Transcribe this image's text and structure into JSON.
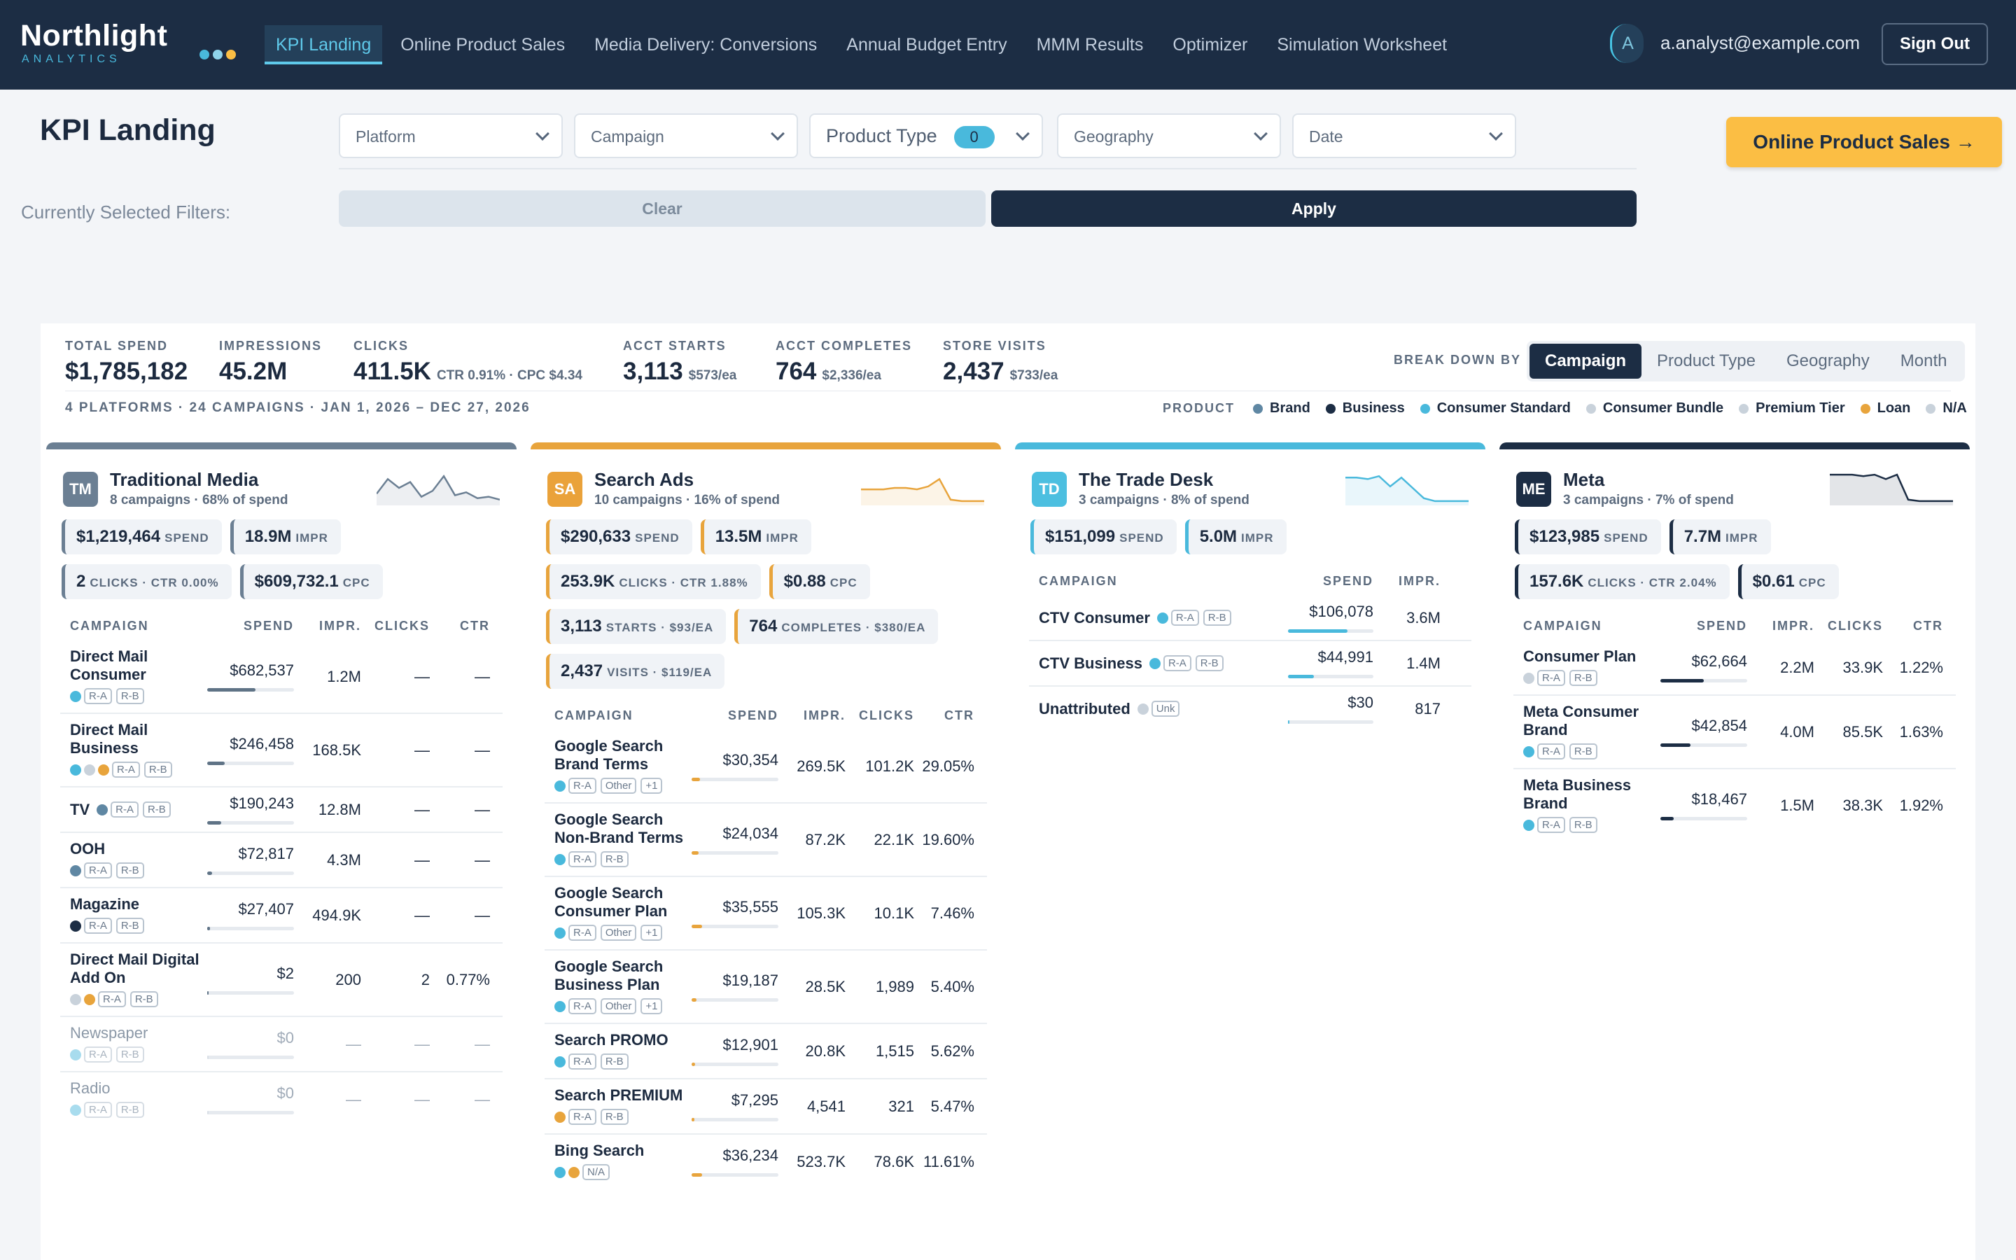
{
  "brand": {
    "name": "Northlight",
    "sub": "ANALYTICS",
    "dots": [
      "#49b9dc",
      "#8fd3ea",
      "#fbbe44"
    ]
  },
  "nav": {
    "tabs": [
      "KPI Landing",
      "Online Product Sales",
      "Media Delivery: Conversions",
      "Annual Budget Entry",
      "MMM Results",
      "Optimizer",
      "Simulation Worksheet"
    ],
    "active": 0,
    "avatar": "A",
    "email": "a.analyst@example.com",
    "sign_out": "Sign Out"
  },
  "page": {
    "title": "KPI Landing",
    "filters": {
      "platform": "Platform",
      "campaign": "Campaign",
      "product_type": "Product Type",
      "product_type_count": "0",
      "geography": "Geography",
      "date": "Date"
    },
    "currently_selected": "Currently Selected Filters:",
    "clear": "Clear",
    "apply": "Apply",
    "cta": "Online Product Sales  →"
  },
  "colors": {
    "navy": "#1c2d44",
    "cyan": "#49b9dc",
    "gold": "#fbbe44",
    "slate": "#6b7f93",
    "orange": "#e8a43c"
  },
  "kpis": [
    {
      "label": "TOTAL SPEND",
      "value": "$1,785,182",
      "sub": ""
    },
    {
      "label": "IMPRESSIONS",
      "value": "45.2M",
      "sub": ""
    },
    {
      "label": "CLICKS",
      "value": "411.5K",
      "sub": "CTR 0.91% · CPC $4.34"
    },
    {
      "label": "ACCT STARTS",
      "value": "3,113",
      "sub": "$573/ea"
    },
    {
      "label": "ACCT COMPLETES",
      "value": "764",
      "sub": "$2,336/ea"
    },
    {
      "label": "STORE VISITS",
      "value": "2,437",
      "sub": "$733/ea"
    }
  ],
  "breakdown": {
    "label": "BREAK DOWN BY",
    "options": [
      "Campaign",
      "Product Type",
      "Geography",
      "Month"
    ],
    "active": 0
  },
  "meta_line": "4 PLATFORMS · 24 CAMPAIGNS · JAN 1, 2026 – DEC 27, 2026",
  "legend": {
    "title": "PRODUCT",
    "items": [
      {
        "name": "Brand",
        "color": "#5f87a3"
      },
      {
        "name": "Business",
        "color": "#1c2d44"
      },
      {
        "name": "Consumer Standard",
        "color": "#49b9dc"
      },
      {
        "name": "Consumer Bundle",
        "color": "#c9d2db"
      },
      {
        "name": "Premium Tier",
        "color": "#c9d2db"
      },
      {
        "name": "Loan",
        "color": "#e8a43c"
      },
      {
        "name": "N/A",
        "color": "#c9d2db"
      }
    ]
  },
  "platforms": [
    {
      "code": "TM",
      "name": "Traditional Media",
      "sub": "8 campaigns · 68% of spend",
      "accent": "#6b7f93",
      "spark": [
        0.7,
        0.2,
        0.5,
        0.3,
        0.8,
        0.6,
        0.1,
        0.75,
        0.65,
        0.85,
        0.8,
        0.9
      ],
      "chips": [
        [
          {
            "v": "$1,219,464",
            "l": "SPEND"
          },
          {
            "v": "18.9M",
            "l": "IMPR"
          }
        ],
        [
          {
            "v": "2",
            "l": "CLICKS · CTR 0.00%"
          },
          {
            "v": "$609,732.1",
            "l": "CPC"
          }
        ]
      ],
      "cols": [
        "CAMPAIGN",
        "SPEND",
        "IMPR.",
        "CLICKS",
        "CTR"
      ],
      "rows": [
        {
          "name": "Direct Mail Consumer",
          "dots": [
            "#49b9dc"
          ],
          "tags": [
            "R-A",
            "R-B"
          ],
          "spend": "$682,537",
          "pct": 0.56,
          "impr": "1.2M",
          "clicks": "—",
          "ctr": "—"
        },
        {
          "name": "Direct Mail Business",
          "dots": [
            "#49b9dc",
            "#c9d2db",
            "#e8a43c"
          ],
          "tags": [
            "R-A",
            "R-B"
          ],
          "spend": "$246,458",
          "pct": 0.2,
          "impr": "168.5K",
          "clicks": "—",
          "ctr": "—"
        },
        {
          "name": "TV",
          "dots": [
            "#5f87a3"
          ],
          "tags": [
            "R-A",
            "R-B"
          ],
          "spend": "$190,243",
          "pct": 0.16,
          "impr": "12.8M",
          "clicks": "—",
          "ctr": "—",
          "inline": true
        },
        {
          "name": "OOH",
          "dots": [
            "#5f87a3"
          ],
          "tags": [
            "R-A",
            "R-B"
          ],
          "spend": "$72,817",
          "pct": 0.06,
          "impr": "4.3M",
          "clicks": "—",
          "ctr": "—"
        },
        {
          "name": "Magazine",
          "dots": [
            "#1c2d44"
          ],
          "tags": [
            "R-A",
            "R-B"
          ],
          "spend": "$27,407",
          "pct": 0.03,
          "impr": "494.9K",
          "clicks": "—",
          "ctr": "—"
        },
        {
          "name": "Direct Mail Digital Add On",
          "dots": [
            "#c9d2db",
            "#e8a43c"
          ],
          "tags": [
            "R-A",
            "R-B"
          ],
          "spend": "$2",
          "pct": 0.0,
          "impr": "200",
          "clicks": "2",
          "ctr": "0.77%"
        },
        {
          "name": "Newspaper",
          "dots": [
            "#a8dcee"
          ],
          "tags": [
            "R-A",
            "R-B"
          ],
          "spend": "$0",
          "pct": 0.0,
          "impr": "—",
          "clicks": "—",
          "ctr": "—",
          "muted": true
        },
        {
          "name": "Radio",
          "dots": [
            "#a8dcee"
          ],
          "tags": [
            "R-A",
            "R-B"
          ],
          "spend": "$0",
          "pct": 0.0,
          "impr": "—",
          "clicks": "—",
          "ctr": "—",
          "muted": true
        }
      ]
    },
    {
      "code": "SA",
      "name": "Search Ads",
      "sub": "10 campaigns · 16% of spend",
      "accent": "#e8a43c",
      "spark": [
        0.55,
        0.55,
        0.55,
        0.5,
        0.5,
        0.55,
        0.45,
        0.2,
        0.9,
        0.95,
        0.95,
        0.95
      ],
      "chips": [
        [
          {
            "v": "$290,633",
            "l": "SPEND"
          },
          {
            "v": "13.5M",
            "l": "IMPR"
          }
        ],
        [
          {
            "v": "253.9K",
            "l": "CLICKS · CTR 1.88%"
          },
          {
            "v": "$0.88",
            "l": "CPC"
          }
        ],
        [
          {
            "v": "3,113",
            "l": "STARTS · $93/EA"
          },
          {
            "v": "764",
            "l": "COMPLETES · $380/EA"
          }
        ],
        [
          {
            "v": "2,437",
            "l": "VISITS · $119/EA"
          }
        ]
      ],
      "cols": [
        "CAMPAIGN",
        "SPEND",
        "IMPR.",
        "CLICKS",
        "CTR"
      ],
      "rows": [
        {
          "name": "Google Search Brand Terms",
          "dots": [
            "#49b9dc"
          ],
          "tags": [
            "R-A",
            "Other",
            "+1"
          ],
          "spend": "$30,354",
          "pct": 0.1,
          "impr": "269.5K",
          "clicks": "101.2K",
          "ctr": "29.05%"
        },
        {
          "name": "Google Search Non-Brand Terms",
          "dots": [
            "#49b9dc"
          ],
          "tags": [
            "R-A",
            "R-B"
          ],
          "spend": "$24,034",
          "pct": 0.08,
          "impr": "87.2K",
          "clicks": "22.1K",
          "ctr": "19.60%"
        },
        {
          "name": "Google Search Consumer Plan",
          "dots": [
            "#49b9dc"
          ],
          "tags": [
            "R-A",
            "Other",
            "+1"
          ],
          "spend": "$35,555",
          "pct": 0.12,
          "impr": "105.3K",
          "clicks": "10.1K",
          "ctr": "7.46%"
        },
        {
          "name": "Google Search Business Plan",
          "dots": [
            "#49b9dc"
          ],
          "tags": [
            "R-A",
            "Other",
            "+1"
          ],
          "spend": "$19,187",
          "pct": 0.06,
          "impr": "28.5K",
          "clicks": "1,989",
          "ctr": "5.40%"
        },
        {
          "name": "Search PROMO",
          "dots": [
            "#49b9dc"
          ],
          "tags": [
            "R-A",
            "R-B"
          ],
          "spend": "$12,901",
          "pct": 0.04,
          "impr": "20.8K",
          "clicks": "1,515",
          "ctr": "5.62%"
        },
        {
          "name": "Search PREMIUM",
          "dots": [
            "#e8a43c"
          ],
          "tags": [
            "R-A",
            "R-B"
          ],
          "spend": "$7,295",
          "pct": 0.03,
          "impr": "4,541",
          "clicks": "321",
          "ctr": "5.47%"
        },
        {
          "name": "Bing Search",
          "dots": [
            "#49b9dc",
            "#e8a43c"
          ],
          "tags": [
            "N/A"
          ],
          "spend": "$36,234",
          "pct": 0.12,
          "impr": "523.7K",
          "clicks": "78.6K",
          "ctr": "11.61%"
        }
      ]
    },
    {
      "code": "TD",
      "name": "The Trade Desk",
      "sub": "3 campaigns · 8% of spend",
      "accent": "#49b9dc",
      "spark": [
        0.15,
        0.15,
        0.2,
        0.1,
        0.45,
        0.15,
        0.5,
        0.85,
        0.95,
        0.95,
        0.95,
        0.95
      ],
      "chips": [
        [
          {
            "v": "$151,099",
            "l": "SPEND"
          },
          {
            "v": "5.0M",
            "l": "IMPR"
          }
        ]
      ],
      "cols": [
        "CAMPAIGN",
        "SPEND",
        "IMPR."
      ],
      "rows": [
        {
          "name": "CTV Consumer",
          "dots": [
            "#49b9dc"
          ],
          "tags": [
            "R-A",
            "R-B"
          ],
          "spend": "$106,078",
          "pct": 0.7,
          "impr": "3.6M",
          "inline": true
        },
        {
          "name": "CTV Business",
          "dots": [
            "#49b9dc"
          ],
          "tags": [
            "R-A",
            "R-B"
          ],
          "spend": "$44,991",
          "pct": 0.3,
          "impr": "1.4M",
          "inline": true
        },
        {
          "name": "Unattributed",
          "dots": [
            "#c9d2db"
          ],
          "tags": [
            "Unk"
          ],
          "spend": "$30",
          "pct": 0.0,
          "impr": "817",
          "inline": true
        }
      ]
    },
    {
      "code": "ME",
      "name": "Meta",
      "sub": "3 campaigns · 7% of spend",
      "accent": "#1c2d44",
      "spark": [
        0.05,
        0.05,
        0.05,
        0.1,
        0.05,
        0.2,
        0.05,
        0.9,
        0.95,
        0.95,
        0.95,
        0.95
      ],
      "chips": [
        [
          {
            "v": "$123,985",
            "l": "SPEND"
          },
          {
            "v": "7.7M",
            "l": "IMPR"
          }
        ],
        [
          {
            "v": "157.6K",
            "l": "CLICKS · CTR 2.04%"
          },
          {
            "v": "$0.61",
            "l": "CPC"
          }
        ]
      ],
      "cols": [
        "CAMPAIGN",
        "SPEND",
        "IMPR.",
        "CLICKS",
        "CTR"
      ],
      "rows": [
        {
          "name": "Consumer Plan",
          "dots": [
            "#c9d2db"
          ],
          "tags": [
            "R-A",
            "R-B"
          ],
          "spend": "$62,664",
          "pct": 0.5,
          "impr": "2.2M",
          "clicks": "33.9K",
          "ctr": "1.22%"
        },
        {
          "name": "Meta Consumer Brand",
          "dots": [
            "#49b9dc"
          ],
          "tags": [
            "R-A",
            "R-B"
          ],
          "spend": "$42,854",
          "pct": 0.35,
          "impr": "4.0M",
          "clicks": "85.5K",
          "ctr": "1.63%"
        },
        {
          "name": "Meta Business Brand",
          "dots": [
            "#49b9dc"
          ],
          "tags": [
            "R-A",
            "R-B"
          ],
          "spend": "$18,467",
          "pct": 0.15,
          "impr": "1.5M",
          "clicks": "38.3K",
          "ctr": "1.92%"
        }
      ]
    }
  ]
}
